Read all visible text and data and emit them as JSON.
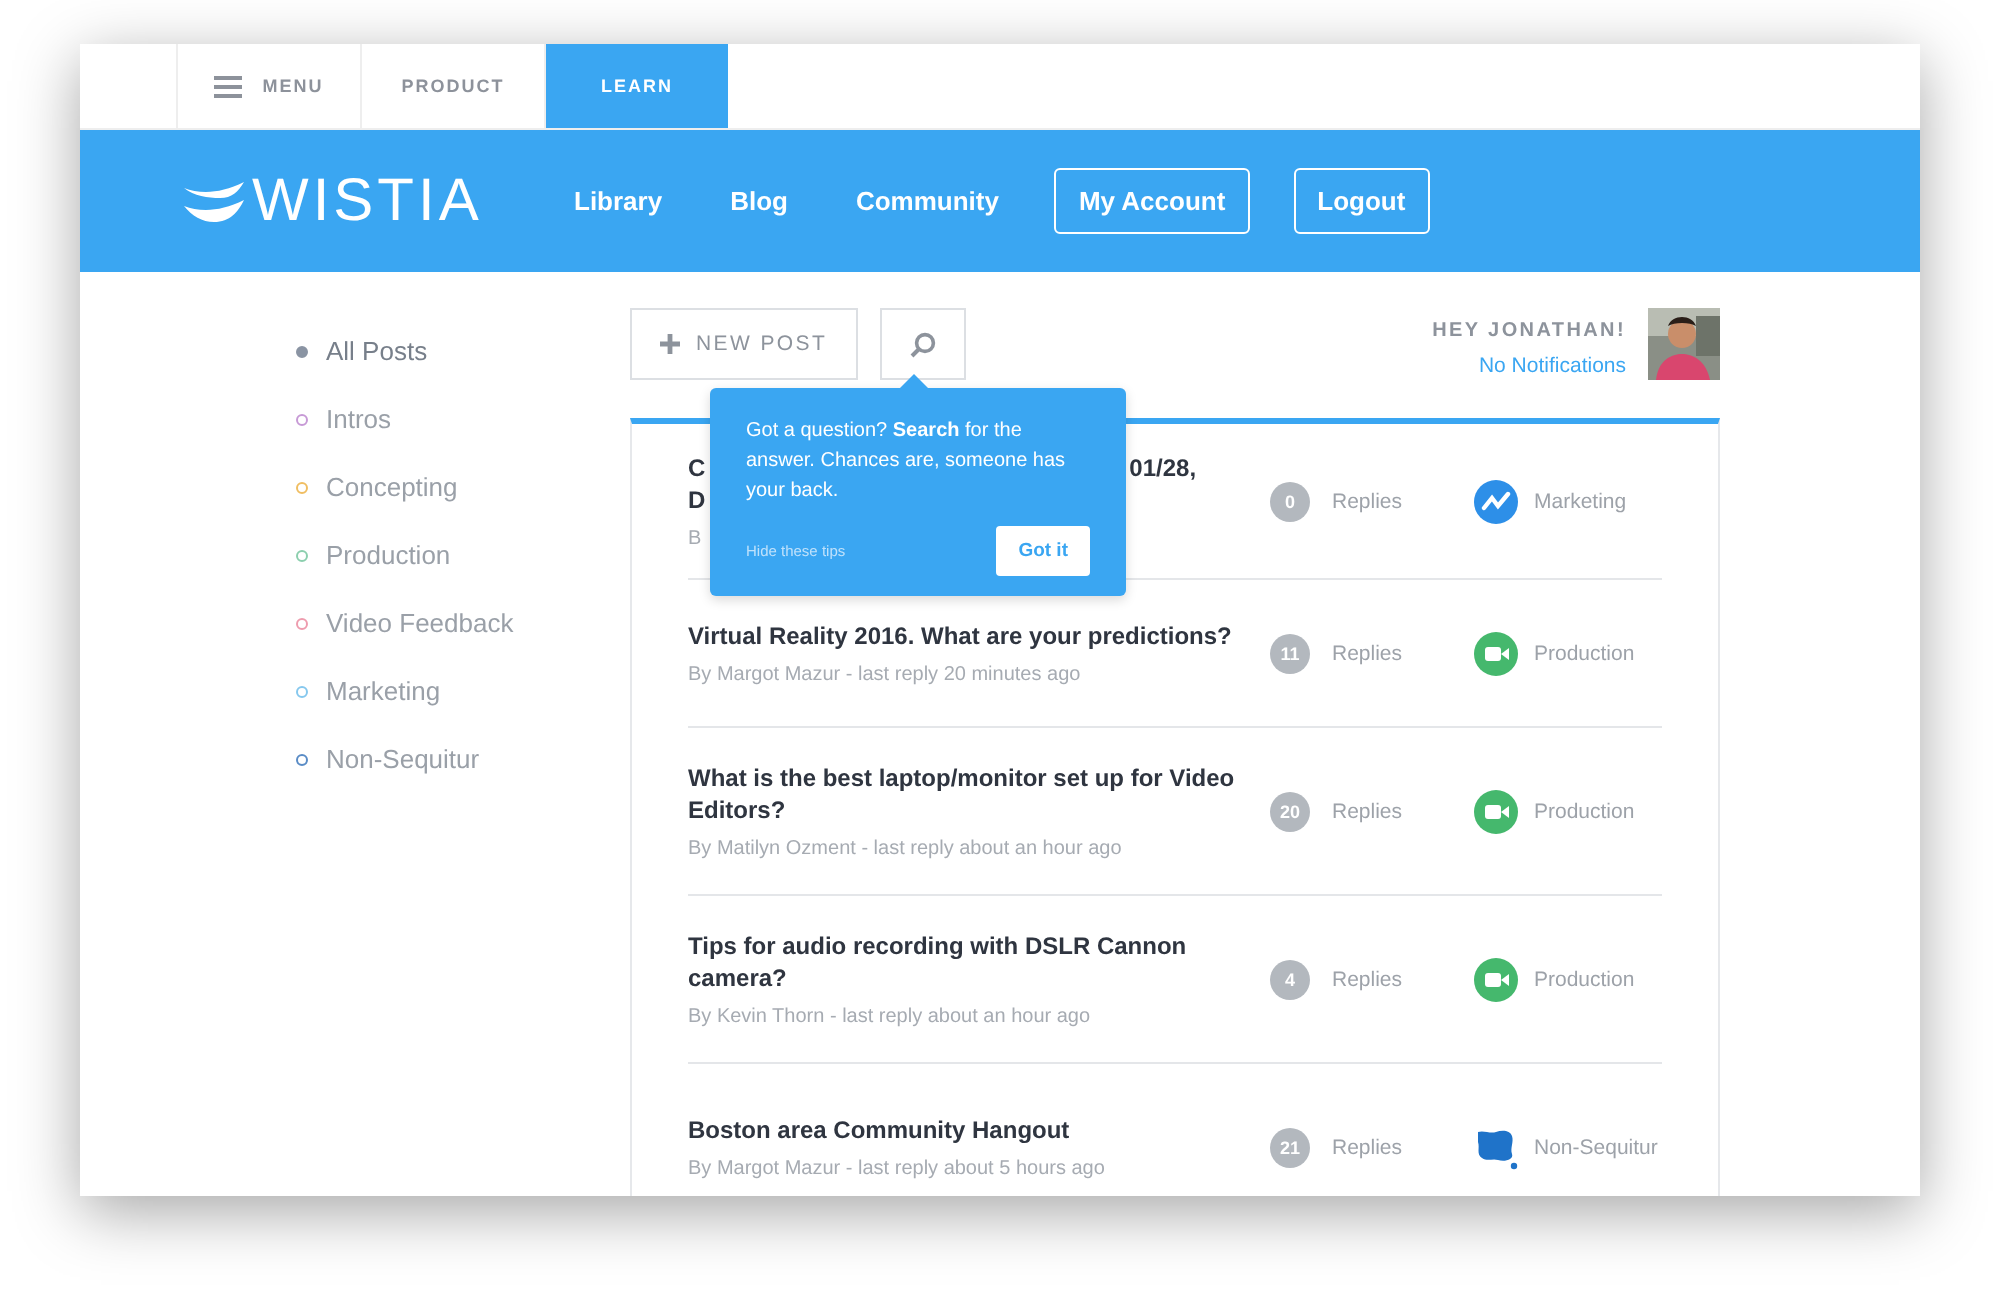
{
  "top_tabs": [
    {
      "label": "MENU",
      "kind": "menu",
      "selected": false
    },
    {
      "label": "PRODUCT",
      "kind": "plain",
      "selected": false
    },
    {
      "label": "LEARN",
      "kind": "plain",
      "selected": true
    }
  ],
  "header": {
    "logo": "WISTIA",
    "nav": [
      {
        "label": "Library",
        "kind": "link"
      },
      {
        "label": "Blog",
        "kind": "link"
      },
      {
        "label": "Community",
        "kind": "link"
      },
      {
        "label": "My Account",
        "kind": "outlined"
      },
      {
        "label": "Logout",
        "kind": "outlined"
      }
    ]
  },
  "sidebar": {
    "items": [
      {
        "label": "All Posts",
        "color": "#8a94a3",
        "selected": true
      },
      {
        "label": "Intros",
        "color": "#c79ad6",
        "selected": false
      },
      {
        "label": "Concepting",
        "color": "#f0be62",
        "selected": false
      },
      {
        "label": "Production",
        "color": "#8ccfae",
        "selected": false
      },
      {
        "label": "Video Feedback",
        "color": "#ee9cae",
        "selected": false
      },
      {
        "label": "Marketing",
        "color": "#86c8ee",
        "selected": false
      },
      {
        "label": "Non-Sequitur",
        "color": "#5a8cc6",
        "selected": false
      }
    ]
  },
  "toolbar": {
    "new_post": "NEW POST"
  },
  "user": {
    "greeting": "HEY JONATHAN!",
    "notifications": "No Notifications"
  },
  "tip": {
    "text": "Got a question? **Search** for the answer. Chances are, someone has your back.",
    "hide": "Hide these tips",
    "button": "Got it"
  },
  "posts": [
    {
      "title_parts": [
        "C",
        "01/28,"
      ],
      "title_line2": "D",
      "meta": "B",
      "replies": "0",
      "replies_label": "Replies",
      "category": "Marketing",
      "kind": "trend"
    },
    {
      "title": "Virtual Reality 2016. What are your predictions?",
      "meta": "By Margot Mazur - last reply 20 minutes ago",
      "replies": "11",
      "replies_label": "Replies",
      "category": "Production",
      "kind": "video"
    },
    {
      "title": "What is the best laptop/monitor set up for Video Editors?",
      "meta": "By Matilyn Ozment - last reply about an hour ago",
      "replies": "20",
      "replies_label": "Replies",
      "category": "Production",
      "kind": "video"
    },
    {
      "title": "Tips for audio recording with DSLR Cannon camera?",
      "meta": "By Kevin Thorn - last reply about an hour ago",
      "replies": "4",
      "replies_label": "Replies",
      "category": "Production",
      "kind": "video"
    },
    {
      "title": "Boston area Community Hangout",
      "meta": "By Margot Mazur - last reply about 5 hours ago",
      "replies": "21",
      "replies_label": "Replies",
      "category": "Non-Sequitur",
      "kind": "blob"
    }
  ]
}
